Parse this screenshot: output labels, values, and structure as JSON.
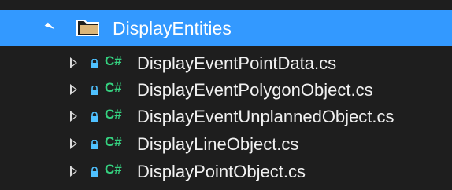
{
  "folder": {
    "label": "DisplayEntities",
    "icon": "folder-open-icon",
    "expanded": true,
    "selected": true,
    "selection_color": "#3399ff"
  },
  "files": [
    {
      "label": "DisplayEventPointData.cs",
      "icon": "csharp-file-icon",
      "badge": "C#"
    },
    {
      "label": "DisplayEventPolygonObject.cs",
      "icon": "csharp-file-icon",
      "badge": "C#"
    },
    {
      "label": "DisplayEventUnplannedObject.cs",
      "icon": "csharp-file-icon",
      "badge": "C#"
    },
    {
      "label": "DisplayLineObject.cs",
      "icon": "csharp-file-icon",
      "badge": "C#"
    },
    {
      "label": "DisplayPointObject.cs",
      "icon": "csharp-file-icon",
      "badge": "C#"
    }
  ],
  "colors": {
    "background": "#1e1e1e",
    "text": "#f1f1f1",
    "csharp_badge": "#35d07f",
    "lock": "#4fc1ff"
  }
}
